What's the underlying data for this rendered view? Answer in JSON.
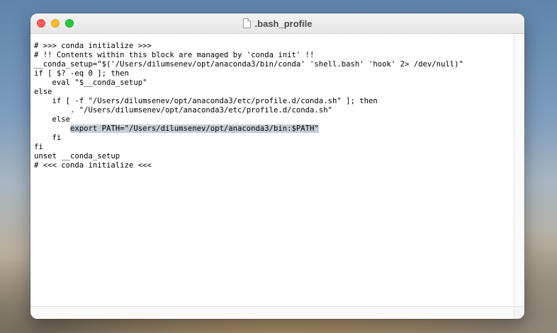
{
  "window": {
    "title": ".bash_profile",
    "title_icon": "document-icon"
  },
  "traffic_lights": {
    "close_color": "#fe5f57",
    "minimize_color": "#febc2e",
    "maximize_color": "#28c840"
  },
  "editor": {
    "selection_color": "#c6cfd8",
    "lines": [
      {
        "text": "# >>> conda initialize >>>"
      },
      {
        "text": "# !! Contents within this block are managed by 'conda init' !!"
      },
      {
        "text": "__conda_setup=\"$('/Users/dilumsenev/opt/anaconda3/bin/conda' 'shell.bash' 'hook' 2> /dev/null)\""
      },
      {
        "text": "if [ $? -eq 0 ]; then"
      },
      {
        "text": "    eval \"$__conda_setup\""
      },
      {
        "text": "else"
      },
      {
        "text": "    if [ -f \"/Users/dilumsenev/opt/anaconda3/etc/profile.d/conda.sh\" ]; then"
      },
      {
        "text": "        . \"/Users/dilumsenev/opt/anaconda3/etc/profile.d/conda.sh\""
      },
      {
        "text": "    else"
      },
      {
        "indent": "        ",
        "selected": "export PATH=\"/Users/dilumsenev/opt/anaconda3/bin:$PATH\""
      },
      {
        "text": "    fi"
      },
      {
        "text": "fi"
      },
      {
        "text": "unset __conda_setup"
      },
      {
        "text": "# <<< conda initialize <<<"
      }
    ]
  }
}
